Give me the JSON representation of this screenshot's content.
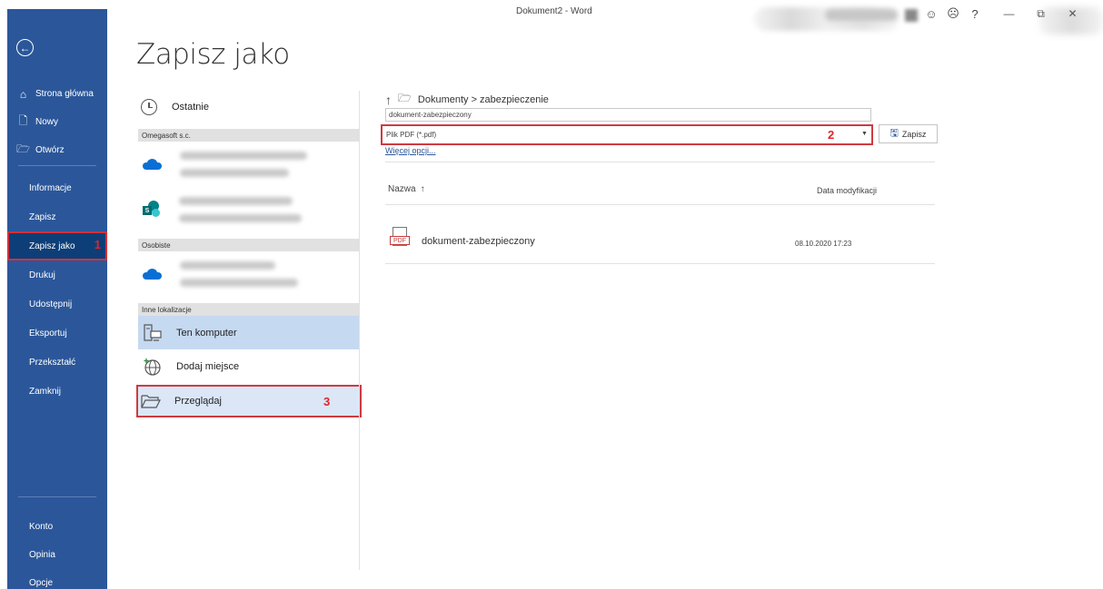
{
  "window": {
    "title": "Dokument2  -  Word",
    "icons": [
      "smiley-icon",
      "frown-icon",
      "help-icon",
      "minimize-icon",
      "restore-icon",
      "close-icon"
    ],
    "glyphs": {
      "smile": "☺",
      "frown": "☹",
      "help": "?",
      "minimize": "—",
      "restore": "⧉",
      "close": "✕"
    }
  },
  "sidebar": {
    "back_glyph": "←",
    "top_items": [
      {
        "label": "Strona główna",
        "icon": "home-icon",
        "glyph": "⌂"
      },
      {
        "label": "Nowy",
        "icon": "new-document-icon",
        "glyph": "🗋"
      },
      {
        "label": "Otwórz",
        "icon": "open-folder-icon",
        "glyph": "🗁"
      }
    ],
    "mid_items": [
      {
        "label": "Informacje"
      },
      {
        "label": "Zapisz"
      },
      {
        "label": "Zapisz jako",
        "active": true,
        "marker": "1"
      },
      {
        "label": "Drukuj"
      },
      {
        "label": "Udostępnij"
      },
      {
        "label": "Eksportuj"
      },
      {
        "label": "Przekształć"
      },
      {
        "label": "Zamknij"
      }
    ],
    "bottom_items": [
      {
        "label": "Konto"
      },
      {
        "label": "Opinia"
      },
      {
        "label": "Opcje"
      }
    ],
    "colors": {
      "background": "#2b579a",
      "active": "#0e3e78",
      "highlight_border": "#d43037"
    }
  },
  "page_title": "Zapisz jako",
  "locations": {
    "recent_label": "Ostatnie",
    "org_section": "Omegasoft s.c.",
    "personal_section": "Osobiste",
    "other_section": "Inne lokalizacje",
    "this_pc": "Ten komputer",
    "add_place": "Dodaj miejsce",
    "browse": "Przeglądaj",
    "browse_marker": "3",
    "sharepoint_letter": "S"
  },
  "save_panel": {
    "up_glyph": "↑",
    "folder_glyph": "🗁",
    "path": "Dokumenty > zabezpieczenie",
    "file_name": "dokument-zabezpieczony",
    "file_type": "Plik PDF (*.pdf)",
    "file_type_marker": "2",
    "dropdown_glyph": "▼",
    "save_label": "Zapisz",
    "save_glyph": "🖫",
    "more_options": "Więcej opcji...",
    "col_name": "Nazwa",
    "sort_glyph": "↑",
    "col_date": "Data modyfikacji",
    "files": [
      {
        "name": "dokument-zabezpieczony",
        "date": "08.10.2020 17:23",
        "icon": "pdf-file-icon",
        "badge": "PDF"
      }
    ],
    "colors": {
      "marker_red": "#e22229",
      "link_blue": "#2b579a"
    }
  }
}
